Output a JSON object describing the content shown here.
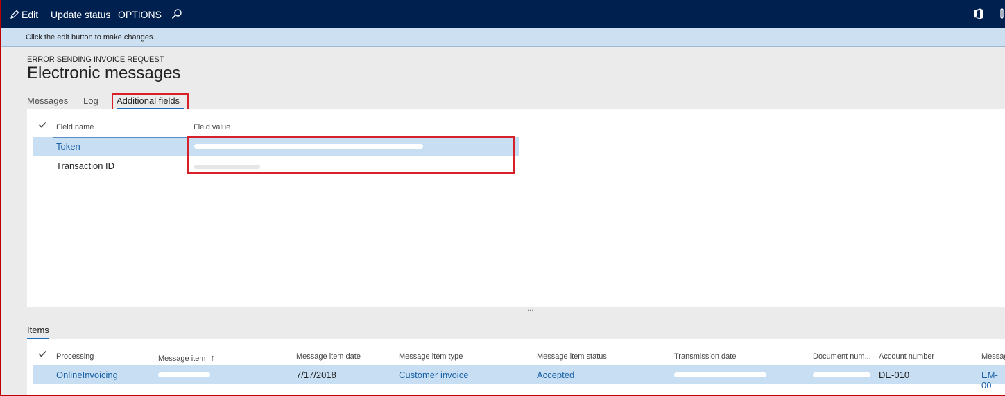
{
  "toolbar": {
    "edit_label": "Edit",
    "update_status_label": "Update status",
    "options_label": "OPTIONS"
  },
  "infobar": {
    "message": "Click the edit button to make changes."
  },
  "page": {
    "caption": "ERROR SENDING INVOICE REQUEST",
    "title": "Electronic messages"
  },
  "tabs": [
    {
      "label": "Messages",
      "selected": false
    },
    {
      "label": "Log",
      "selected": false
    },
    {
      "label": "Additional fields",
      "selected": true
    }
  ],
  "fields_grid": {
    "columns": [
      "Field name",
      "Field value"
    ],
    "rows": [
      {
        "name": "Token",
        "value": "",
        "selected": true
      },
      {
        "name": "Transaction ID",
        "value": ""
      }
    ]
  },
  "splitter_glyph": "...",
  "items": {
    "label": "Items",
    "columns": [
      "Processing",
      "Message item",
      "Message item date",
      "Message item type",
      "Message item status",
      "Transmission date",
      "Document num...",
      "Account number",
      "Messag"
    ],
    "sort_indicator": "↑",
    "rows": [
      {
        "processing": "OnlineInvoicing",
        "message_item": "",
        "message_item_date": "7/17/2018",
        "message_item_type": "Customer invoice",
        "message_item_status": "Accepted",
        "transmission_date": "",
        "document_number": "",
        "account_number": "DE-010",
        "message": "EM-00"
      }
    ]
  },
  "colors": {
    "topbar": "#002050",
    "infobar": "#cde0f1",
    "accent": "#1b6bb8",
    "link": "#1b62a8",
    "selected_row": "#c8dff3",
    "highlight": "#d6202a"
  },
  "icons": [
    "pencil-icon",
    "search-icon",
    "office-icon",
    "attachment-icon",
    "checkmark-icon"
  ]
}
